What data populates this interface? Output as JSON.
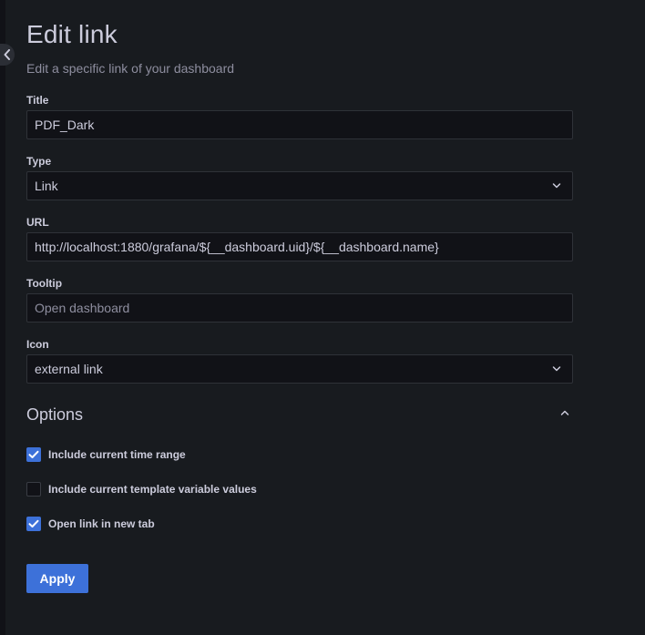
{
  "page": {
    "title": "Edit link",
    "subtitle": "Edit a specific link of your dashboard"
  },
  "fields": {
    "title": {
      "label": "Title",
      "value": "PDF_Dark"
    },
    "type": {
      "label": "Type",
      "value": "Link"
    },
    "url": {
      "label": "URL",
      "value": "http://localhost:1880/grafana/${__dashboard.uid}/${__dashboard.name}"
    },
    "tooltip": {
      "label": "Tooltip",
      "value": "",
      "placeholder": "Open dashboard"
    },
    "icon": {
      "label": "Icon",
      "value": "external link"
    }
  },
  "options": {
    "title": "Options",
    "expanded": true,
    "items": [
      {
        "label": "Include current time range",
        "checked": true
      },
      {
        "label": "Include current template variable values",
        "checked": false
      },
      {
        "label": "Open link in new tab",
        "checked": true
      }
    ]
  },
  "actions": {
    "apply_label": "Apply"
  },
  "colors": {
    "background": "#181b1f",
    "input_background": "#111217",
    "input_border": "#2f3238",
    "text_primary": "#ccccdc",
    "text_secondary": "#8e8e9f",
    "accent": "#3d71d9"
  },
  "icons": {
    "collapse": "chevron-left-icon",
    "select": "chevron-down-icon",
    "options_toggle": "chevron-up-icon",
    "checkmark": "check-icon"
  }
}
